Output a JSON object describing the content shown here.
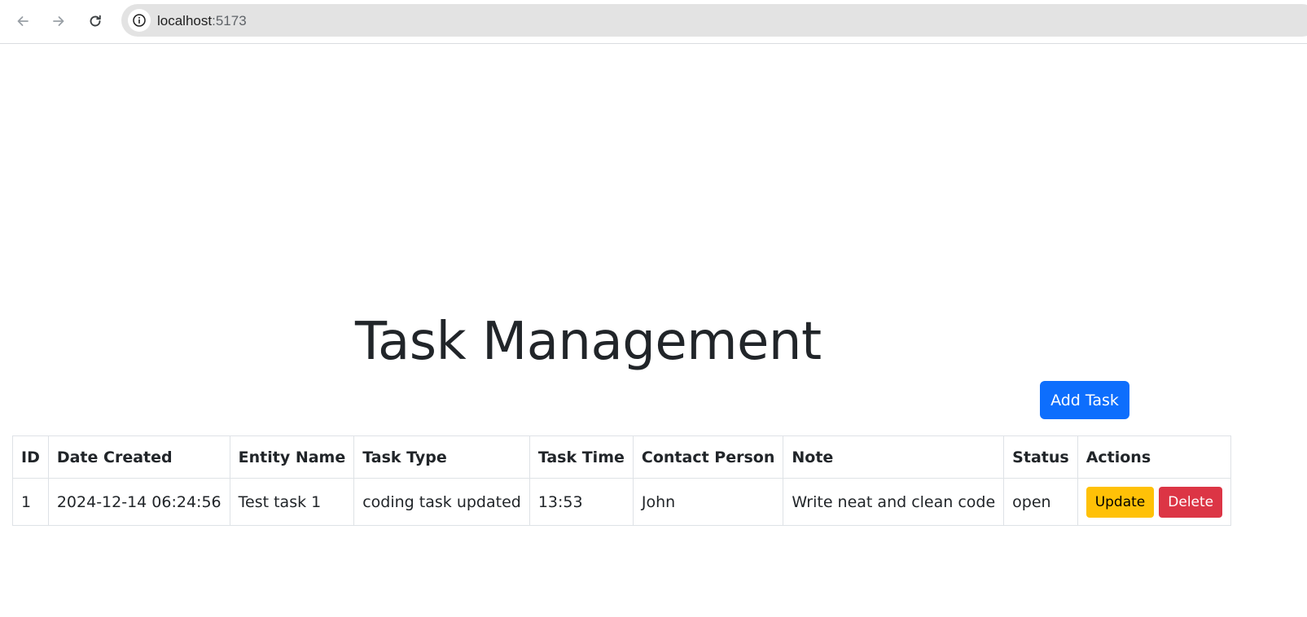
{
  "browser": {
    "url_host": "localhost",
    "url_port": ":5173",
    "icons": [
      "back-arrow-icon",
      "forward-arrow-icon",
      "reload-icon",
      "info-icon"
    ]
  },
  "page": {
    "title": "Task Management",
    "add_button_label": "Add Task"
  },
  "table": {
    "headers": [
      "ID",
      "Date Created",
      "Entity Name",
      "Task Type",
      "Task Time",
      "Contact Person",
      "Note",
      "Status",
      "Actions"
    ],
    "rows": [
      {
        "id": "1",
        "date_created": "2024-12-14 06:24:56",
        "entity_name": "Test task 1",
        "task_type": "coding task updated",
        "task_time": "13:53",
        "contact_person": "John",
        "note": "Write neat and clean code",
        "status": "open",
        "update_label": "Update",
        "delete_label": "Delete"
      }
    ]
  },
  "colors": {
    "primary": "#0d6efd",
    "warning": "#ffc107",
    "danger": "#dc3545"
  }
}
